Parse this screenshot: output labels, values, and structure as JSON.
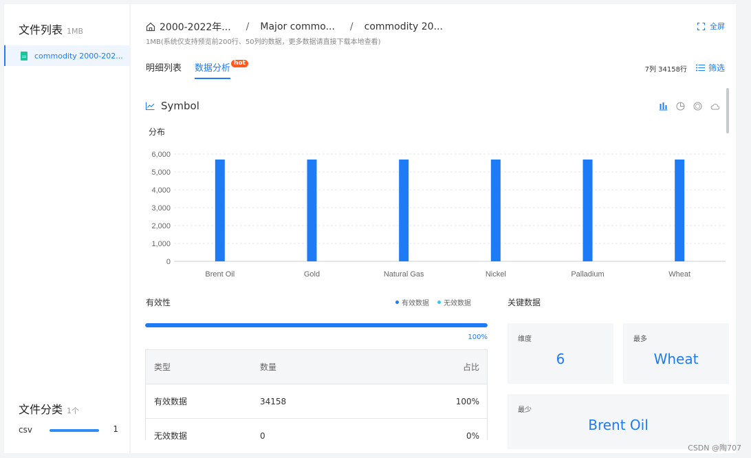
{
  "sidebar": {
    "title": "文件列表",
    "size": "1MB",
    "files": [
      {
        "name": "commodity 2000-202..."
      }
    ],
    "category_title": "文件分类",
    "category_count": "1个",
    "categories": [
      {
        "name": "csv",
        "count": "1",
        "fraction": 1.0
      }
    ]
  },
  "header": {
    "breadcrumb": [
      "2000-2022年...",
      "Major commo...",
      "commodity 20..."
    ],
    "subtitle": "1MB(系统仅支持预览前200行、50列的数据，更多数据请直接下载本地查看)",
    "fullscreen_label": "全屏"
  },
  "tabs": {
    "detail": "明细列表",
    "analysis": "数据分析",
    "hot_badge": "hot"
  },
  "toolbar": {
    "row_info": "7列 34158行",
    "filter_label": "筛选"
  },
  "panel": {
    "title": "Symbol",
    "chart_label": "分布"
  },
  "chart_data": {
    "type": "bar",
    "categories": [
      "Brent Oil",
      "Gold",
      "Natural Gas",
      "Nickel",
      "Palladium",
      "Wheat"
    ],
    "values": [
      5693,
      5693,
      5693,
      5693,
      5693,
      5693
    ],
    "ylim": [
      0,
      6000
    ],
    "yticks": [
      "0",
      "1,000",
      "2,000",
      "3,000",
      "4,000",
      "5,000",
      "6,000"
    ],
    "bar_color": "#1e7bf6",
    "grid": true
  },
  "validity": {
    "title": "有效性",
    "legend_valid": "有效数据",
    "legend_invalid": "无效数据",
    "valid_color": "#1e7bf6",
    "invalid_color": "#36c6f5",
    "valid_fraction": 1.0,
    "percent_label": "100%",
    "table": {
      "headers": [
        "类型",
        "数量",
        "占比"
      ],
      "rows": [
        [
          "有效数据",
          "34158",
          "100%"
        ],
        [
          "无效数据",
          "0",
          "0%"
        ]
      ]
    }
  },
  "key_data": {
    "title": "关键数据",
    "dimension_label": "维度",
    "dimension_value": "6",
    "most_label": "最多",
    "most_value": "Wheat",
    "least_label": "最少",
    "least_value": "Brent Oil"
  },
  "watermark": "CSDN @陶707"
}
